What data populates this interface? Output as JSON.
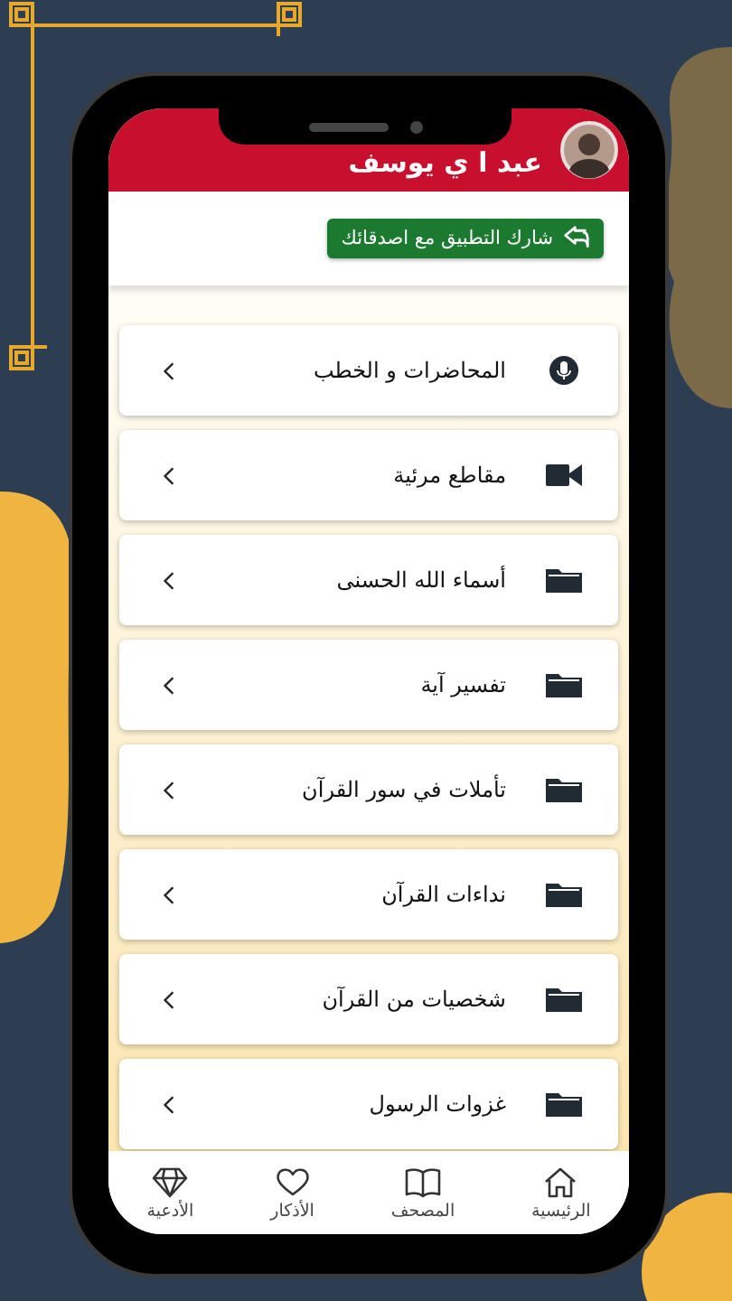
{
  "header": {
    "title": "عبد ا ي يوسف"
  },
  "share_button": {
    "label": "شارك التطبيق مع اصدقائك"
  },
  "menu_items": [
    {
      "label": "المحاضرات و الخطب",
      "kind": "mic"
    },
    {
      "label": "مقاطع مرئية",
      "kind": "video"
    },
    {
      "label": "أسماء الله الحسنى",
      "kind": "folder"
    },
    {
      "label": "تفسير آية",
      "kind": "folder"
    },
    {
      "label": "تأملات في سور القرآن",
      "kind": "folder"
    },
    {
      "label": "نداءات القرآن",
      "kind": "folder"
    },
    {
      "label": "شخصيات من القرآن",
      "kind": "folder"
    },
    {
      "label": "غزوات الرسول",
      "kind": "folder"
    }
  ],
  "bottom_nav": [
    {
      "label": "الرئيسية",
      "kind": "home"
    },
    {
      "label": "المصحف",
      "kind": "book"
    },
    {
      "label": "الأذكار",
      "kind": "heart"
    },
    {
      "label": "الأدعية",
      "kind": "diamond"
    }
  ]
}
